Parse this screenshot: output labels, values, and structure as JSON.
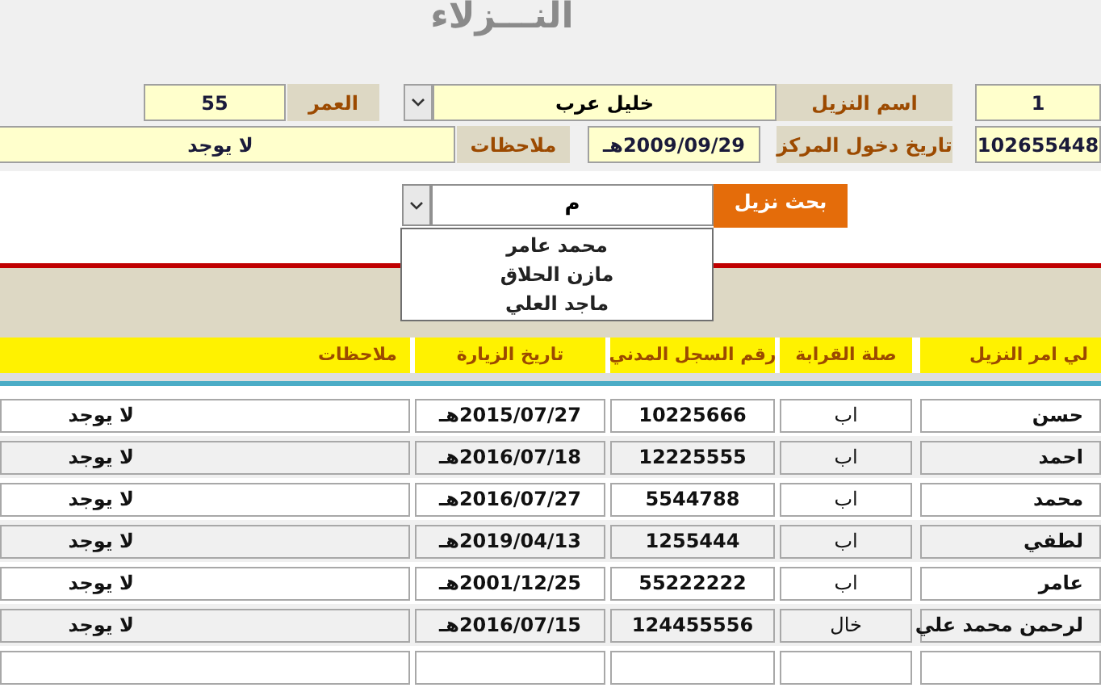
{
  "title": "النـــزلاء",
  "form": {
    "rows": [
      [
        {
          "kind": "field",
          "value": "1"
        },
        {
          "kind": "label",
          "text": "اسم النزيل"
        },
        {
          "kind": "combo",
          "value": "خليل عرب"
        },
        {
          "kind": "label",
          "text": "العمر"
        },
        {
          "kind": "field",
          "value": "55"
        }
      ],
      [
        {
          "kind": "field",
          "value": "102655448"
        },
        {
          "kind": "label",
          "text": "تاريخ دخول المركز"
        },
        {
          "kind": "field",
          "value": "2009/09/29هـ"
        },
        {
          "kind": "label",
          "text": "ملاحظات"
        },
        {
          "kind": "field",
          "value": "لا يوجد"
        }
      ]
    ]
  },
  "search": {
    "button": "بحث نزيل",
    "value": "م",
    "expanded": true,
    "options": [
      "محمد عامر",
      "مازن الحلاق",
      "ماجد العلي"
    ]
  },
  "table": {
    "columns": [
      "لي امر النزيل",
      "صلة القرابة",
      "رقم السجل المدني",
      "تاريخ الزيارة",
      "ملاحظات"
    ],
    "rows": [
      [
        "حسن",
        "اب",
        "10225666",
        "2015/07/27هـ",
        "لا يوجد"
      ],
      [
        "احمد",
        "اب",
        "12225555",
        "2016/07/18هـ",
        "لا يوجد"
      ],
      [
        "محمد",
        "اب",
        "5544788",
        "2016/07/27هـ",
        "لا يوجد"
      ],
      [
        "لطفي",
        "اب",
        "1255444",
        "2019/04/13هـ",
        "لا يوجد"
      ],
      [
        "عامر",
        "اب",
        "55222222",
        "2001/12/25هـ",
        "لا يوجد"
      ],
      [
        "لرحمن محمد علي",
        "خال",
        "124455556",
        "2016/07/15هـ",
        "لا يوجد"
      ]
    ]
  }
}
